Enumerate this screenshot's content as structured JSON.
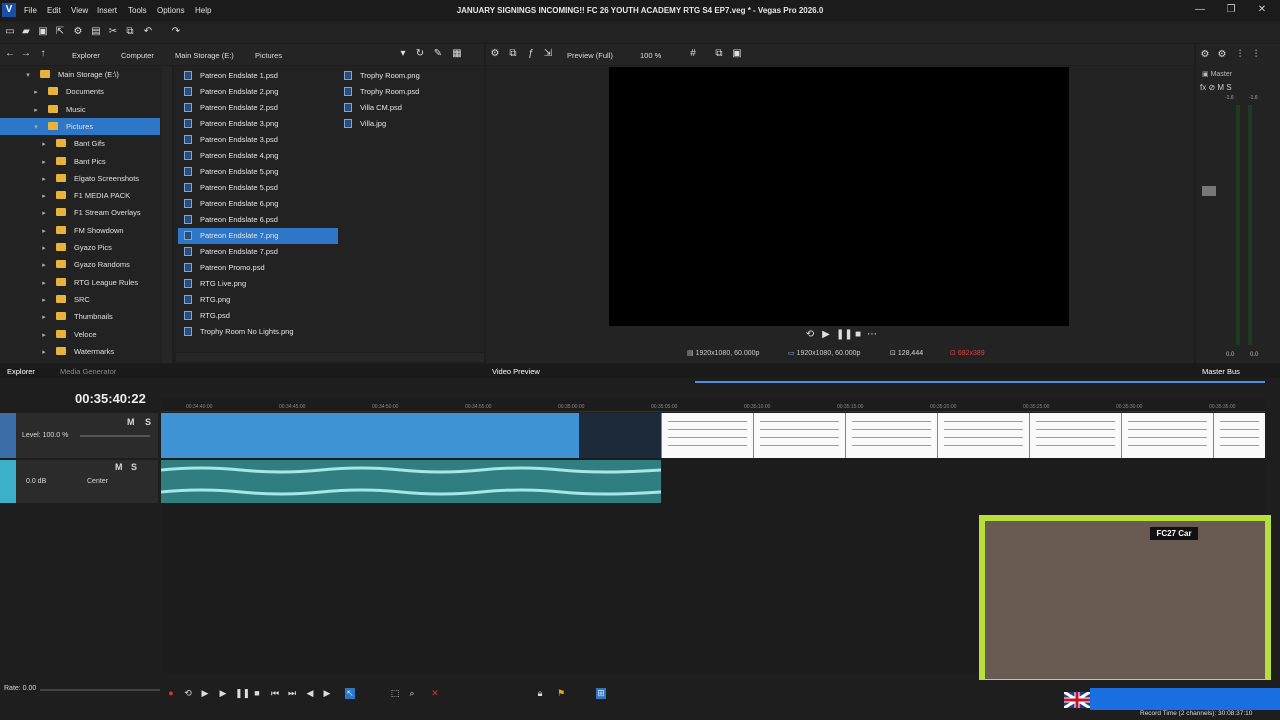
{
  "app": {
    "logo": "V",
    "title": "JANUARY SIGNINGS INCOMING!! FC 26 YOUTH ACADEMY RTG S4 EP7.veg * - Vegas Pro 2026.0"
  },
  "menu": [
    "File",
    "Edit",
    "View",
    "Insert",
    "Tools",
    "Options",
    "Help"
  ],
  "explorer": {
    "breadcrumbs": [
      "Explorer",
      "Computer",
      "Main Storage (E:)",
      "Pictures"
    ],
    "tree": [
      {
        "label": "Main Storage (E:\\)",
        "level": 0,
        "expanded": true
      },
      {
        "label": "Documents",
        "level": 1
      },
      {
        "label": "Music",
        "level": 1
      },
      {
        "label": "Pictures",
        "level": 1,
        "selected": true,
        "expanded": true
      },
      {
        "label": "Bant Gifs",
        "level": 2
      },
      {
        "label": "Bant Pics",
        "level": 2
      },
      {
        "label": "Elgato Screenshots",
        "level": 2
      },
      {
        "label": "F1 MEDIA PACK",
        "level": 2
      },
      {
        "label": "F1 Stream Overlays",
        "level": 2
      },
      {
        "label": "FM Showdown",
        "level": 2
      },
      {
        "label": "Gyazo Pics",
        "level": 2
      },
      {
        "label": "Gyazo Randoms",
        "level": 2
      },
      {
        "label": "RTG League Rules",
        "level": 2
      },
      {
        "label": "SRC",
        "level": 2
      },
      {
        "label": "Thumbnails",
        "level": 2
      },
      {
        "label": "Veloce",
        "level": 2
      },
      {
        "label": "Watermarks",
        "level": 2
      }
    ],
    "files_col1": [
      "Patreon Endslate 1.psd",
      "Patreon Endslate 2.png",
      "Patreon Endslate 2.psd",
      "Patreon Endslate 3.png",
      "Patreon Endslate 3.psd",
      "Patreon Endslate 4.png",
      "Patreon Endslate 5.png",
      "Patreon Endslate 5.psd",
      "Patreon Endslate 6.png",
      "Patreon Endslate 6.psd",
      "Patreon Endslate 7.png",
      "Patreon Endslate 7.psd",
      "Patreon Promo.psd",
      "RTG Live.png",
      "RTG.png",
      "RTG.psd",
      "Trophy Room No Lights.png"
    ],
    "selected_file": "Patreon Endslate 7.png",
    "files_col2": [
      "Trophy Room.png",
      "Trophy Room.psd",
      "Villa CM.psd",
      "Villa.jpg"
    ]
  },
  "preview": {
    "mode": "Preview (Full)",
    "zoom": "100 %",
    "project": "1920x1080, 60.000p",
    "preview_res": "1920x1080, 60.000p",
    "frame": "128,444",
    "display": "692x389"
  },
  "master": {
    "label": "Master",
    "left_val": "0.0",
    "right_val": "0.0",
    "peak_l": "-1.6",
    "peak_r": "-1.6"
  },
  "tabs": {
    "explorer": "Explorer",
    "media_generator": "Media Generator",
    "video_preview": "Video Preview",
    "master_bus": "Master Bus"
  },
  "timeline": {
    "timecode": "00:35:40:22",
    "ruler": [
      "00:34:40:00",
      "00:34:45:00",
      "00:34:50:00",
      "00:34:55:00",
      "00:35:00:00",
      "00:35:05:00",
      "00:35:10:00",
      "00:35:15:00",
      "00:35:20:00",
      "00:35:25:00",
      "00:35:30:00",
      "00:35:35:00"
    ],
    "video_track": {
      "level": "Level: 100.0 %",
      "m": "M",
      "s": "S"
    },
    "audio_track": {
      "volume": "0.0 dB",
      "pan": "Center",
      "m": "M",
      "s": "S"
    }
  },
  "webcam_overlay": "FC27 Car",
  "status": {
    "rate": "Rate: 0.00",
    "record_time": "Record Time (2 channels): 30:08:37:10"
  }
}
